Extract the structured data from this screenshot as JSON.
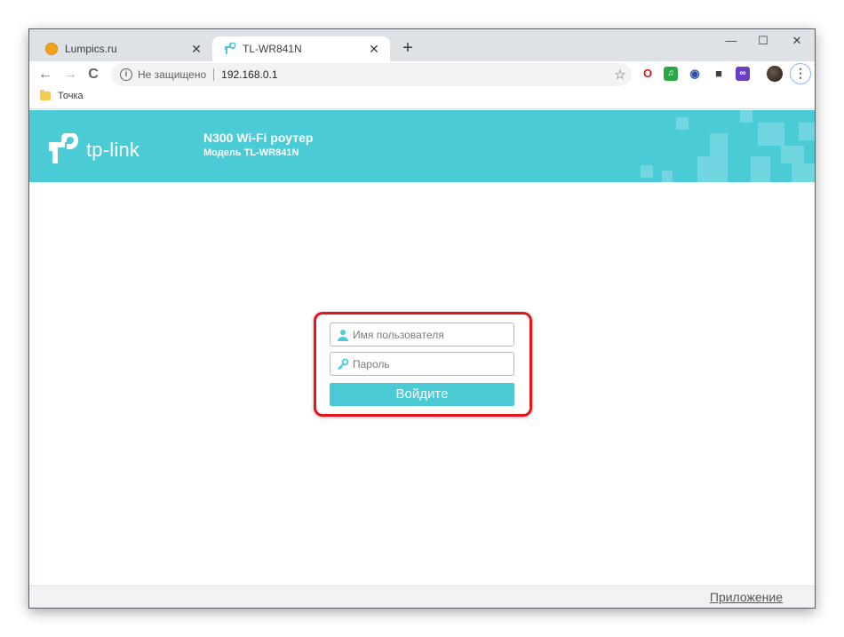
{
  "browser": {
    "tabs": [
      {
        "title": "Lumpics.ru",
        "icon": "lumpics-icon",
        "active": false
      },
      {
        "title": "TL-WR841N",
        "icon": "tp-link-icon",
        "active": true
      }
    ],
    "tab_close": "✕",
    "new_tab": "+",
    "window_controls": {
      "minimize": "—",
      "maximize": "☐",
      "close": "✕"
    },
    "nav": {
      "back": "←",
      "forward": "→",
      "reload": "C"
    },
    "address": {
      "security_status": "Не защищено",
      "url": "192.168.0.1"
    },
    "bookmark_star": "☆",
    "extensions": [
      {
        "name": "opera-icon",
        "glyph": "O",
        "color": "#e0141e"
      },
      {
        "name": "music-icon",
        "glyph": "♫",
        "color": "#2aa845"
      },
      {
        "name": "globe-icon",
        "glyph": "◉",
        "color": "#2c4fa8"
      },
      {
        "name": "box-extension-icon",
        "glyph": "■",
        "color": "#3c4043"
      },
      {
        "name": "link-extension-icon",
        "glyph": "∞",
        "color": "#6b3fc4"
      }
    ],
    "menu": "⋮",
    "bookmarks": [
      {
        "label": "Точка"
      }
    ]
  },
  "router": {
    "logo_text": "tp-link",
    "title": "N300 Wi-Fi роутер",
    "model": "Модель TL-WR841N",
    "accent_color": "#4acbd6",
    "login": {
      "username_placeholder": "Имя пользователя",
      "password_placeholder": "Пароль",
      "submit_label": "Войдите"
    },
    "footer_link": "Приложение"
  }
}
